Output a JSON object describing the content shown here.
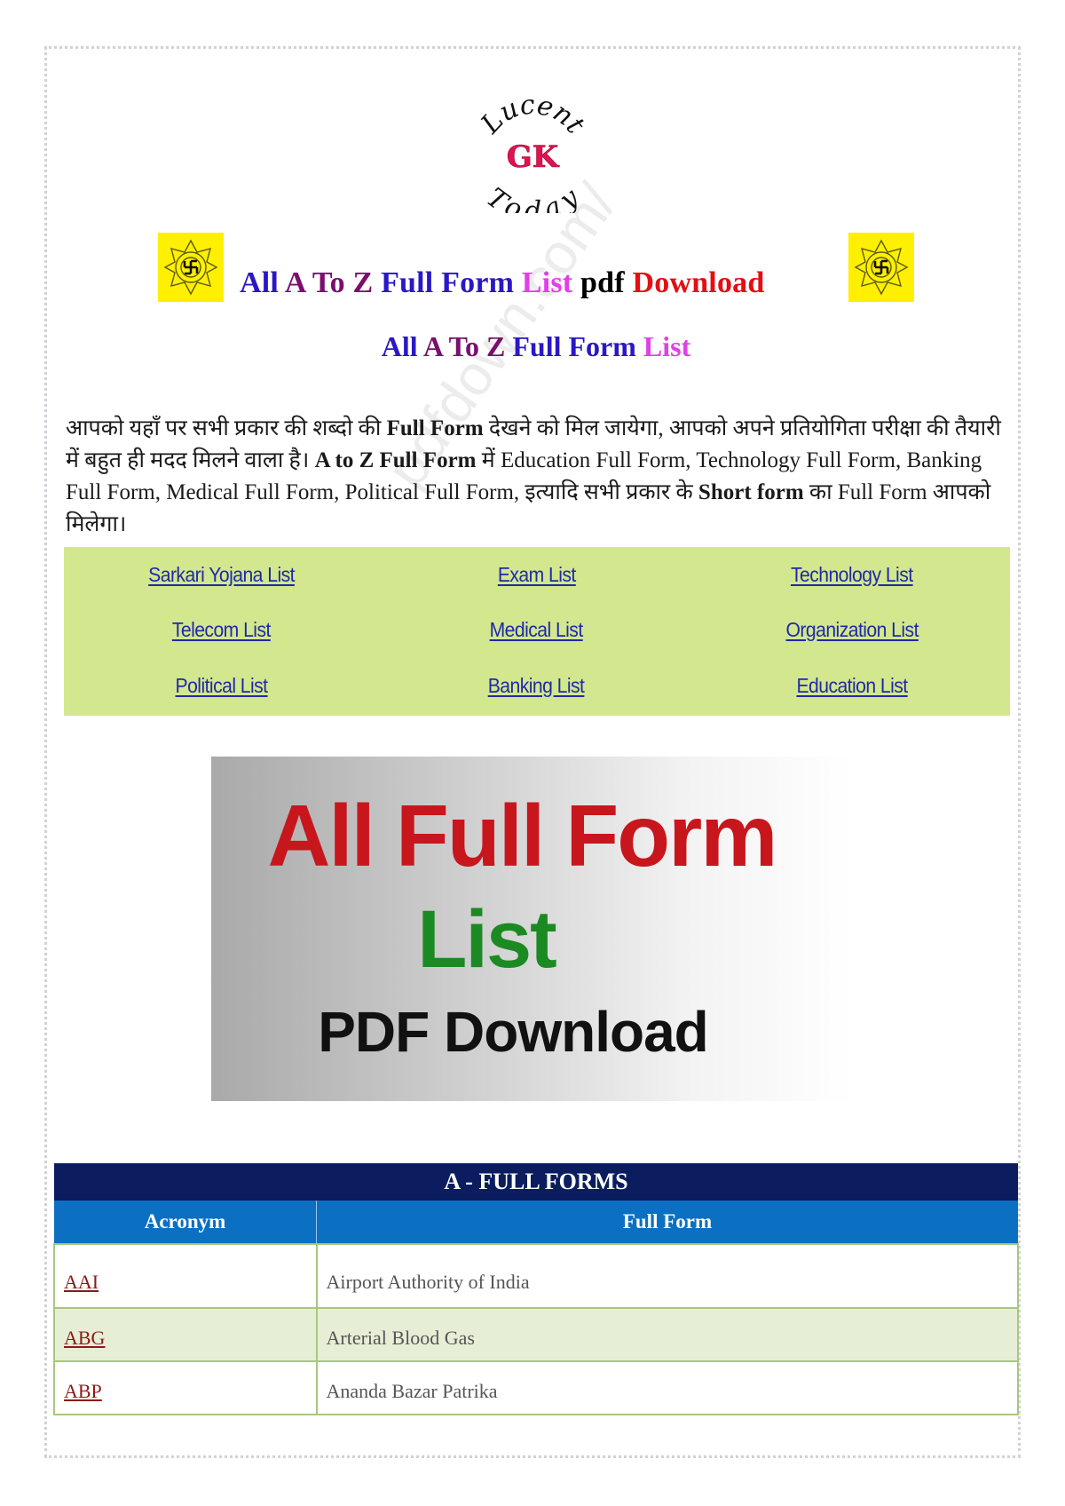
{
  "logo": {
    "top_text": "Lucent",
    "middle_text": "GK",
    "bottom_text": "Today",
    "middle_color": "#e0124f"
  },
  "heading": {
    "words": [
      {
        "text": "All",
        "color": "#2a18c4"
      },
      {
        "text": "A To Z",
        "color": "#7a0f6e"
      },
      {
        "text": "Full Form",
        "color": "#2a18c4"
      },
      {
        "text": "List",
        "color": "#e040e6"
      },
      {
        "text": "pdf",
        "color": "#000000"
      },
      {
        "text": "Download",
        "color": "#e30f12"
      }
    ],
    "icon": "swastik-star-icon"
  },
  "subheading": {
    "w1": "All",
    "w2": "A To Z",
    "w3": "Full Form",
    "w4": "List"
  },
  "intro": {
    "p1": "आपको यहाँ पर सभी प्रकार की शब्दो की ",
    "b1": "Full Form",
    "p2": " देखने को मिल जायेगा, आपको अपने प्रतियोगिता परीक्षा की तैयारी में बहुत ही मदद मिलने वाला है। ",
    "b2": "A to Z Full Form",
    "p3": " में Education Full Form, Technology Full Form, Banking Full Form, Medical Full Form, Political Full Form, इत्यादि सभी प्रकार के ",
    "b3": "Short form",
    "p4": " का Full Form आपको मिलेगा।"
  },
  "links": [
    "Sarkari Yojana List",
    "Exam List",
    "Technology List",
    "Telecom List",
    "Medical List",
    "Organization List",
    "Political List",
    "Banking List",
    "Education List"
  ],
  "banner": {
    "line1": "All Full Form",
    "line2": "List",
    "line3": "PDF Download"
  },
  "table": {
    "title": "A - FULL FORMS",
    "columns": [
      "Acronym",
      "Full Form"
    ],
    "rows": [
      {
        "acronym": "AAI",
        "full_form": "Airport Authority of India"
      },
      {
        "acronym": "ABG",
        "full_form": "Arterial Blood Gas"
      },
      {
        "acronym": "ABP",
        "full_form": "Ananda Bazar Patrika"
      }
    ]
  },
  "colors": {
    "link_box_bg": "#d3e78e",
    "link_color": "#1f2aa8",
    "table_title_bg": "#0b1d5f",
    "table_header_bg": "#0b70c2",
    "acronym_color": "#8b1a1a"
  }
}
